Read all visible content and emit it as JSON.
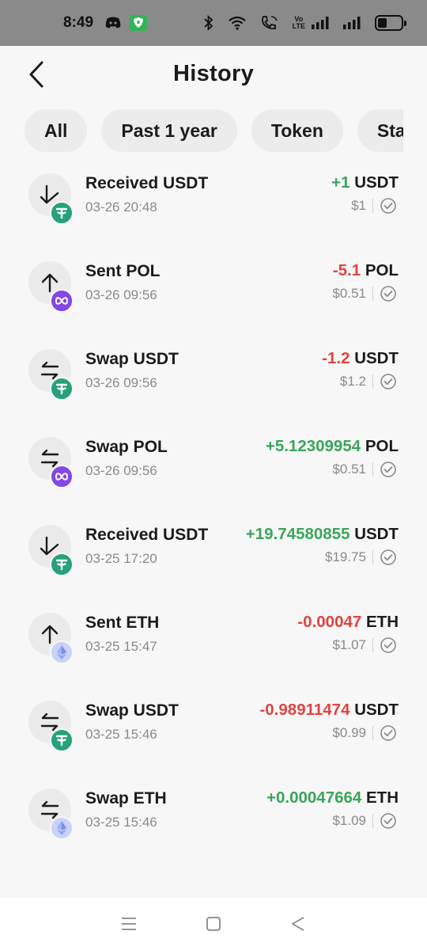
{
  "status_bar": {
    "time": "8:49",
    "volte_top": "Vo",
    "volte_bottom": "LTE"
  },
  "header": {
    "title": "History"
  },
  "filters": [
    "All",
    "Past 1 year",
    "Token",
    "Stat"
  ],
  "transactions": [
    {
      "title": "Received USDT",
      "date": "03-26 20:48",
      "amount": "+1",
      "symbol": "USDT",
      "fiat": "$1",
      "direction": "in",
      "token": "usdt"
    },
    {
      "title": "Sent POL",
      "date": "03-26 09:56",
      "amount": "-5.1",
      "symbol": "POL",
      "fiat": "$0.51",
      "direction": "out",
      "token": "pol"
    },
    {
      "title": "Swap USDT",
      "date": "03-26 09:56",
      "amount": "-1.2",
      "symbol": "USDT",
      "fiat": "$1.2",
      "direction": "swap",
      "token": "usdt"
    },
    {
      "title": "Swap POL",
      "date": "03-26 09:56",
      "amount": "+5.12309954",
      "symbol": "POL",
      "fiat": "$0.51",
      "direction": "swap",
      "token": "pol"
    },
    {
      "title": "Received USDT",
      "date": "03-25 17:20",
      "amount": "+19.74580855",
      "symbol": "USDT",
      "fiat": "$19.75",
      "direction": "in",
      "token": "usdt"
    },
    {
      "title": "Sent ETH",
      "date": "03-25 15:47",
      "amount": "-0.00047",
      "symbol": "ETH",
      "fiat": "$1.07",
      "direction": "out",
      "token": "eth"
    },
    {
      "title": "Swap USDT",
      "date": "03-25 15:46",
      "amount": "-0.98911474",
      "symbol": "USDT",
      "fiat": "$0.99",
      "direction": "swap",
      "token": "usdt"
    },
    {
      "title": "Swap ETH",
      "date": "03-25 15:46",
      "amount": "+0.00047664",
      "symbol": "ETH",
      "fiat": "$1.09",
      "direction": "swap",
      "token": "eth"
    }
  ],
  "colors": {
    "positive": "#3aa55a",
    "negative": "#e0443f",
    "usdt": "#26a17b",
    "pol": "#8247e5",
    "eth": "#c9d2f7"
  },
  "icons": {
    "in": "arrow-down-left-icon",
    "out": "arrow-up-icon",
    "swap": "swap-arrows-icon",
    "usdt": "tether-icon",
    "pol": "polygon-icon",
    "eth": "ethereum-icon"
  }
}
